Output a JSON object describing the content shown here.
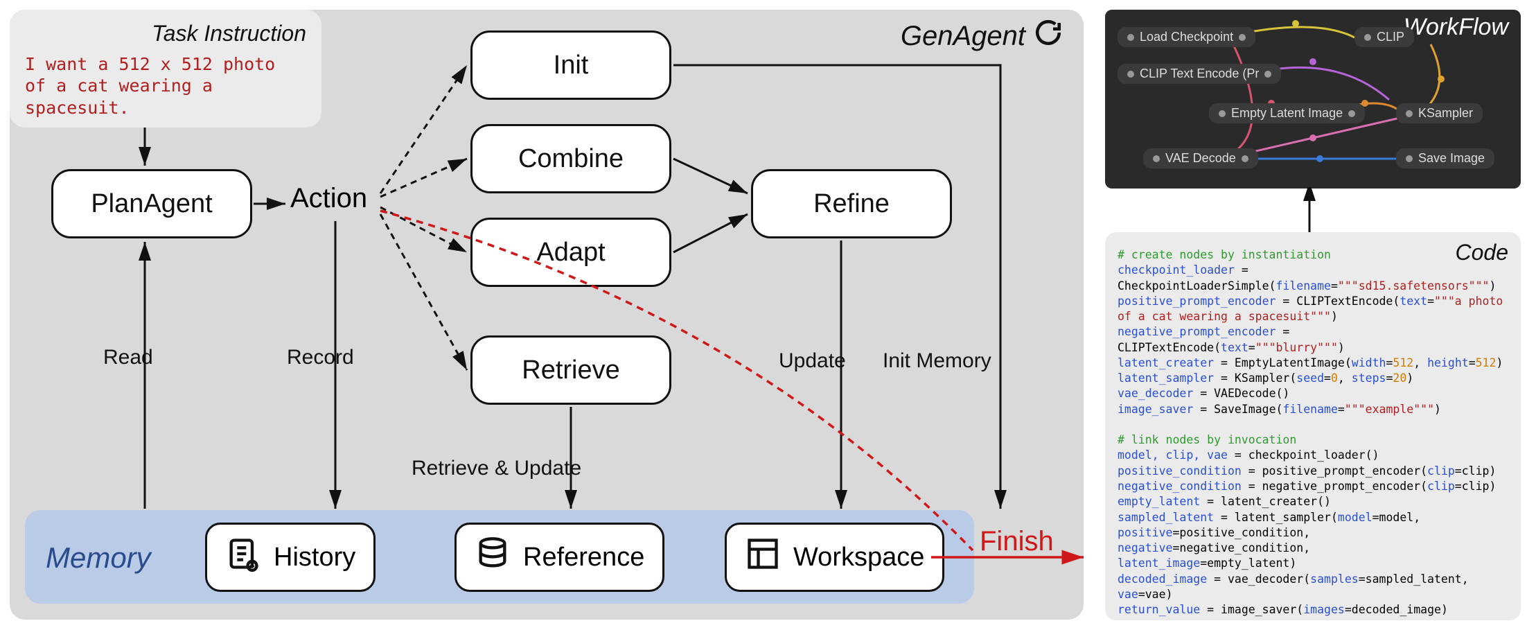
{
  "task": {
    "title": "Task Instruction",
    "text": "I want a 512 x 512 photo of a cat wearing a spacesuit."
  },
  "genagent_title": "GenAgent",
  "nodes": {
    "plan": "PlanAgent",
    "action": "Action",
    "init": "Init",
    "combine": "Combine",
    "adapt": "Adapt",
    "retrieve": "Retrieve",
    "refine": "Refine"
  },
  "edge_labels": {
    "read": "Read",
    "record": "Record",
    "retrieve_update": "Retrieve & Update",
    "update": "Update",
    "init_memory": "Init Memory"
  },
  "memory": {
    "title": "Memory",
    "history": "History",
    "reference": "Reference",
    "workspace": "Workspace"
  },
  "finish": "Finish",
  "workflow": {
    "title": "WorkFlow",
    "nodes": {
      "load_checkpoint": "Load Checkpoint",
      "clip_a": "CLIP",
      "clip_b": "CLIP Text Encode (Pr",
      "empty_latent": "Empty Latent Image",
      "ksampler": "KSampler",
      "vae_decode": "VAE Decode",
      "save_image": "Save Image"
    }
  },
  "code": {
    "title": "Code",
    "comment1": "# create nodes by instantiation",
    "line1a": "checkpoint_loader",
    "line1b": "CheckpointLoaderSimple(",
    "line1c": "filename",
    "line1d": "\"\"\"sd15.safetensors\"\"\"",
    "line2a": "positive_prompt_encoder",
    "line2b": "CLIPTextEncode(",
    "line2c": "text",
    "line2d": "\"\"\"a photo of a cat wearing a spacesuit\"\"\"",
    "line3a": "negative_prompt_encoder",
    "line3b": "CLIPTextEncode(",
    "line3c": "text",
    "line3d": "\"\"\"blurry\"\"\"",
    "line4a": "latent_creater",
    "line4b": "EmptyLatentImage(",
    "line4c": "width",
    "line4d": "512",
    "line4e": "height",
    "line4f": "512",
    "line5a": "latent_sampler",
    "line5b": "KSampler(",
    "line5c": "seed",
    "line5d": "0",
    "line5e": "steps",
    "line5f": "20",
    "line6a": "vae_decoder",
    "line6b": "VAEDecode()",
    "line7a": "image_saver",
    "line7b": "SaveImage(",
    "line7c": "filename",
    "line7d": "\"\"\"example\"\"\"",
    "comment2": "# link nodes by invocation",
    "l1": "model, clip, vae",
    "l1b": "checkpoint_loader()",
    "l2": "positive_condition",
    "l2b": "positive_prompt_encoder(",
    "l2c": "clip",
    "l2d": "clip",
    "l3": "negative_condition",
    "l3b": "negative_prompt_encoder(",
    "l3c": "clip",
    "l3d": "clip",
    "l4": "empty_latent",
    "l4b": "latent_creater()",
    "l5": "sampled_latent",
    "l5b": "latent_sampler(",
    "l5c": "model",
    "l5d": "model",
    "l5e": "positive",
    "l5f": "positive_condition",
    "l5g": "negative",
    "l5h": "negative_condition",
    "l5i": "latent_image",
    "l5j": "empty_latent",
    "l6": "decoded_image",
    "l6b": "vae_decoder(",
    "l6c": "samples",
    "l6d": "sampled_latent",
    "l6e": "vae",
    "l6f": "vae",
    "l7": "return_value",
    "l7b": "image_saver(",
    "l7c": "images",
    "l7d": "decoded_image"
  }
}
